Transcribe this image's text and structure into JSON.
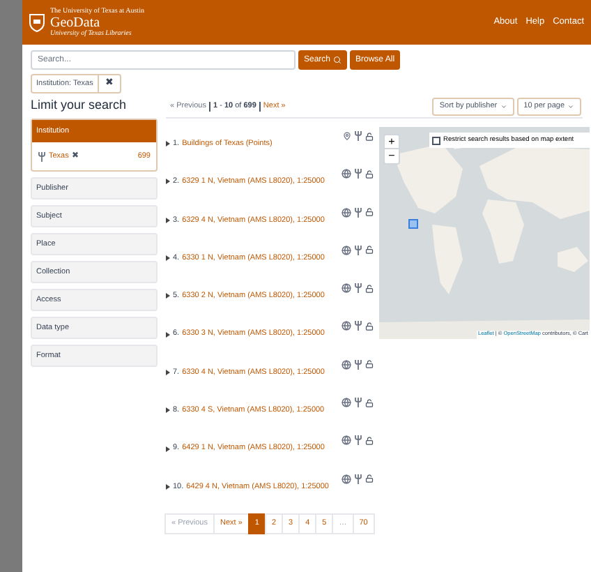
{
  "header": {
    "university": "The University of Texas at Austin",
    "title": "GeoData",
    "subtitle": "University of Texas Libraries",
    "nav": [
      "About",
      "Help",
      "Contact"
    ]
  },
  "search": {
    "placeholder": "Search...",
    "search_button": "Search",
    "browse_button": "Browse All"
  },
  "filter_chip": {
    "label": "Institution: Texas",
    "remove": "✖"
  },
  "sidebar": {
    "title": "Limit your search",
    "facets": [
      {
        "label": "Institution",
        "expanded": true,
        "values": [
          {
            "label": "Texas",
            "remove": "✖",
            "count": "699"
          }
        ]
      },
      {
        "label": "Publisher",
        "expanded": false
      },
      {
        "label": "Subject",
        "expanded": false
      },
      {
        "label": "Place",
        "expanded": false
      },
      {
        "label": "Collection",
        "expanded": false
      },
      {
        "label": "Access",
        "expanded": false
      },
      {
        "label": "Data type",
        "expanded": false
      },
      {
        "label": "Format",
        "expanded": false
      }
    ]
  },
  "results_nav": {
    "previous": "« Previous",
    "range": "**1** - **10** of **699**",
    "next": "Next »"
  },
  "sort": {
    "label": "Sort by publisher"
  },
  "per_page": {
    "label": "10 per page"
  },
  "results": [
    {
      "number": "1.",
      "title": "Buildings of Texas (Points)",
      "kind": "point"
    },
    {
      "number": "2.",
      "title": "6329 1 N, Vietnam (AMS L8020), 1:25000",
      "kind": "raster"
    },
    {
      "number": "3.",
      "title": "6329 4 N, Vietnam (AMS L8020), 1:25000",
      "kind": "raster"
    },
    {
      "number": "4.",
      "title": "6330 1 N, Vietnam (AMS L8020), 1:25000",
      "kind": "raster"
    },
    {
      "number": "5.",
      "title": "6330 2 N, Vietnam (AMS L8020), 1:25000",
      "kind": "raster"
    },
    {
      "number": "6.",
      "title": "6330 3 N, Vietnam (AMS L8020), 1:25000",
      "kind": "raster"
    },
    {
      "number": "7.",
      "title": "6330 4 N, Vietnam (AMS L8020), 1:25000",
      "kind": "raster"
    },
    {
      "number": "8.",
      "title": "6330 4 S, Vietnam (AMS L8020), 1:25000",
      "kind": "raster"
    },
    {
      "number": "9.",
      "title": "6429 1 N, Vietnam (AMS L8020), 1:25000",
      "kind": "raster"
    },
    {
      "number": "10.",
      "title": "6429 4 N, Vietnam (AMS L8020), 1:25000",
      "kind": "raster"
    }
  ],
  "map": {
    "zoom_in": "+",
    "zoom_out": "−",
    "restrict": {
      "label": "Restrict search results based on map extent",
      "checked": false
    },
    "attribution": {
      "leaflet": "Leaflet",
      "separator": "| ©",
      "osm": "OpenStreetMap",
      "rest": "contributors, © Cart"
    }
  },
  "pagination": [
    {
      "label": "« Previous",
      "disabled": true,
      "selected": false
    },
    {
      "label": "Next »",
      "disabled": false,
      "selected": false
    },
    {
      "label": "1",
      "disabled": false,
      "selected": true
    },
    {
      "label": "2",
      "disabled": false,
      "selected": false
    },
    {
      "label": "3",
      "disabled": false,
      "selected": false
    },
    {
      "label": "4",
      "disabled": false,
      "selected": false
    },
    {
      "label": "5",
      "disabled": false,
      "selected": false
    },
    {
      "label": "…",
      "disabled": true,
      "selected": false
    },
    {
      "label": "70",
      "disabled": false,
      "selected": false
    }
  ]
}
